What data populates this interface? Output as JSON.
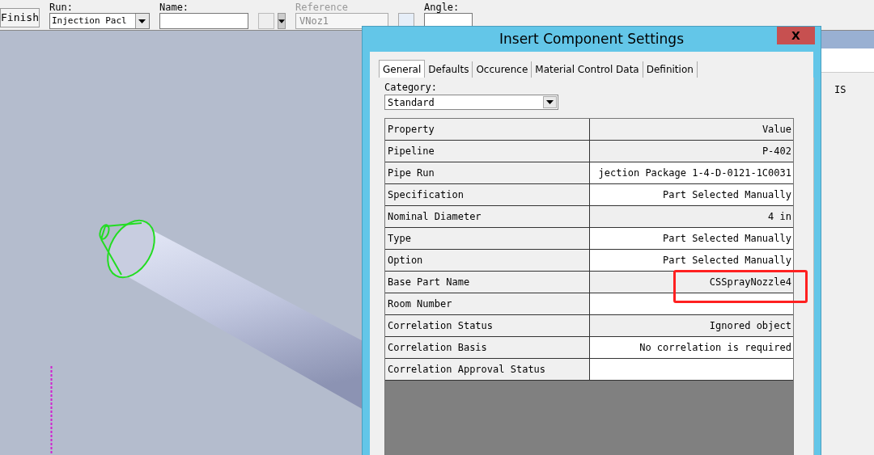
{
  "toolbar": {
    "finish_button": "Finish",
    "run": {
      "label": "Run:",
      "value": "Injection Pacl"
    },
    "name": {
      "label": "Name:"
    },
    "reference": {
      "label": "Reference",
      "value": "VNoz1",
      "disabled": true
    },
    "angle": {
      "label": "Angle:"
    }
  },
  "side_panel": {
    "text": "IS"
  },
  "dialog": {
    "title": "Insert Component Settings",
    "close": "X",
    "tabs": [
      {
        "label": "General",
        "selected": true
      },
      {
        "label": "Defaults",
        "selected": false
      },
      {
        "label": "Occurence",
        "selected": false
      },
      {
        "label": "Material Control Data",
        "selected": false
      },
      {
        "label": "Definition",
        "selected": false
      }
    ],
    "category": {
      "label": "Category:",
      "value": "Standard"
    },
    "table": {
      "columns": [
        "Property",
        "Value"
      ],
      "rows": [
        {
          "property": "Pipeline",
          "value": "P-402",
          "shaded": true,
          "highlighted": false
        },
        {
          "property": "Pipe Run",
          "value": "jection Package 1-4-D-0121-1C0031",
          "shaded": false,
          "highlighted": false
        },
        {
          "property": "Specification",
          "value": "Part Selected Manually",
          "shaded": false,
          "highlighted": false
        },
        {
          "property": "Nominal Diameter",
          "value": "4 in",
          "shaded": true,
          "highlighted": false
        },
        {
          "property": "Type",
          "value": "Part Selected Manually",
          "shaded": false,
          "highlighted": false
        },
        {
          "property": "Option",
          "value": "Part Selected Manually",
          "shaded": false,
          "highlighted": false
        },
        {
          "property": "Base Part Name",
          "value": "CSSprayNozzle4",
          "shaded": true,
          "highlighted": true
        },
        {
          "property": "Room Number",
          "value": "",
          "shaded": false,
          "highlighted": false
        },
        {
          "property": "Correlation Status",
          "value": "Ignored object",
          "shaded": true,
          "highlighted": false
        },
        {
          "property": "Correlation Basis",
          "value": "No correlation is required",
          "shaded": false,
          "highlighted": false
        },
        {
          "property": "Correlation Approval Status",
          "value": "",
          "shaded": false,
          "highlighted": false
        }
      ]
    }
  }
}
